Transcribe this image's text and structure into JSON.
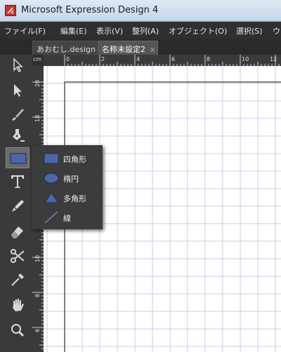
{
  "window": {
    "title": "Microsoft Expression Design 4",
    "app_icon_glyph": "4"
  },
  "menu": {
    "items": [
      "ファイル(F)",
      "編集(E)",
      "表示(V)",
      "整列(A)",
      "オブジェクト(O)",
      "選択(S)",
      "ウ"
    ]
  },
  "tabs": [
    {
      "label": "あおむし.design",
      "close": ""
    },
    {
      "label": "名称未設定2",
      "close": "×"
    }
  ],
  "ruler": {
    "unit": "cm",
    "h_labels": [
      "0",
      "2",
      "4",
      "6",
      "8",
      "10",
      "12"
    ],
    "v_labels": [
      "20",
      "18",
      "16",
      "14",
      "12",
      "10",
      "8",
      "6"
    ]
  },
  "tools": [
    {
      "name": "selection-tool",
      "icon": "white-arrow-icon"
    },
    {
      "name": "direct-selection-tool",
      "icon": "black-arrow-icon"
    },
    {
      "name": "brush-tool",
      "icon": "brush-icon"
    },
    {
      "name": "pen-tool",
      "icon": "pen-nib-icon"
    },
    {
      "name": "rectangle-tool",
      "icon": "rectangle-icon",
      "selected": true
    },
    {
      "name": "text-tool",
      "icon": "text-t-icon"
    },
    {
      "name": "stroke-brush-tool",
      "icon": "brush-stroke-icon"
    },
    {
      "name": "eraser-tool",
      "icon": "eraser-icon"
    },
    {
      "name": "scissors-tool",
      "icon": "scissors-icon"
    },
    {
      "name": "eyedropper-tool",
      "icon": "eyedropper-icon"
    },
    {
      "name": "pan-tool",
      "icon": "hand-icon"
    },
    {
      "name": "zoom-tool",
      "icon": "magnifier-icon"
    }
  ],
  "shape_popup": {
    "items": [
      {
        "label": "四角形",
        "icon": "rectangle-icon"
      },
      {
        "label": "楕円",
        "icon": "ellipse-icon"
      },
      {
        "label": "多角形",
        "icon": "polygon-icon"
      },
      {
        "label": "線",
        "icon": "line-icon"
      }
    ]
  },
  "colors": {
    "shape_fill": "#4a67a8",
    "grid": "#c9cce6",
    "canvas": "#ffffff"
  }
}
